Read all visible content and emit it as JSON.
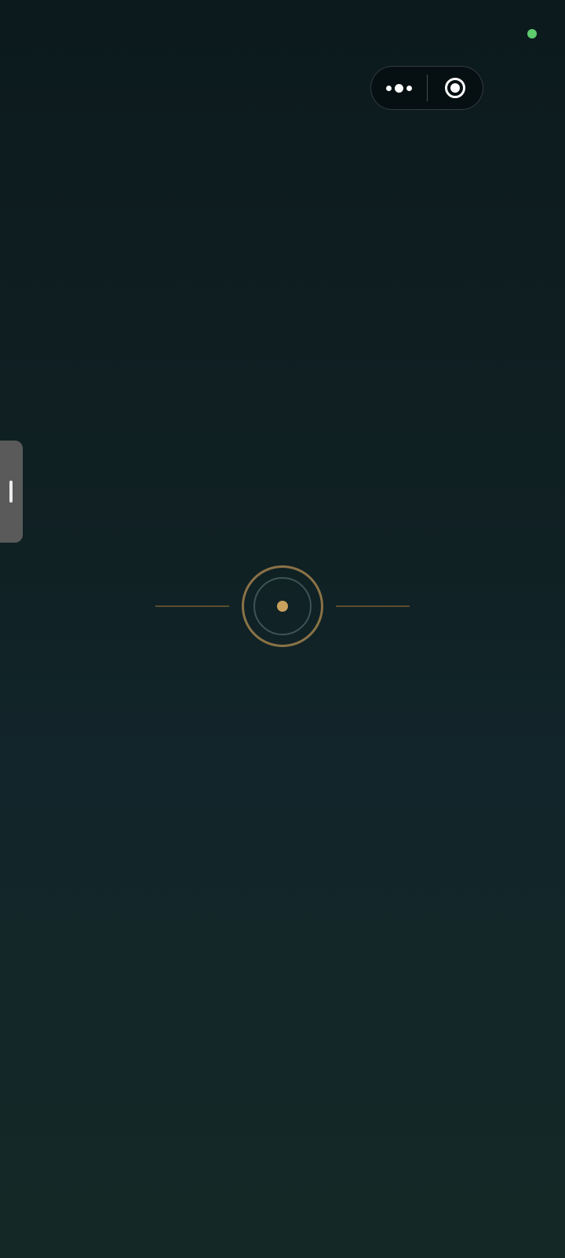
{
  "status": {
    "indicator_color": "#5ecb6e"
  },
  "capsule": {
    "more_icon": "more-dots-icon",
    "close_icon": "target-close-icon"
  },
  "side_handle": {
    "icon": "drag-grip-icon"
  },
  "loader": {
    "icon": "loading-ring-icon",
    "accent_color": "#c9a15c"
  }
}
